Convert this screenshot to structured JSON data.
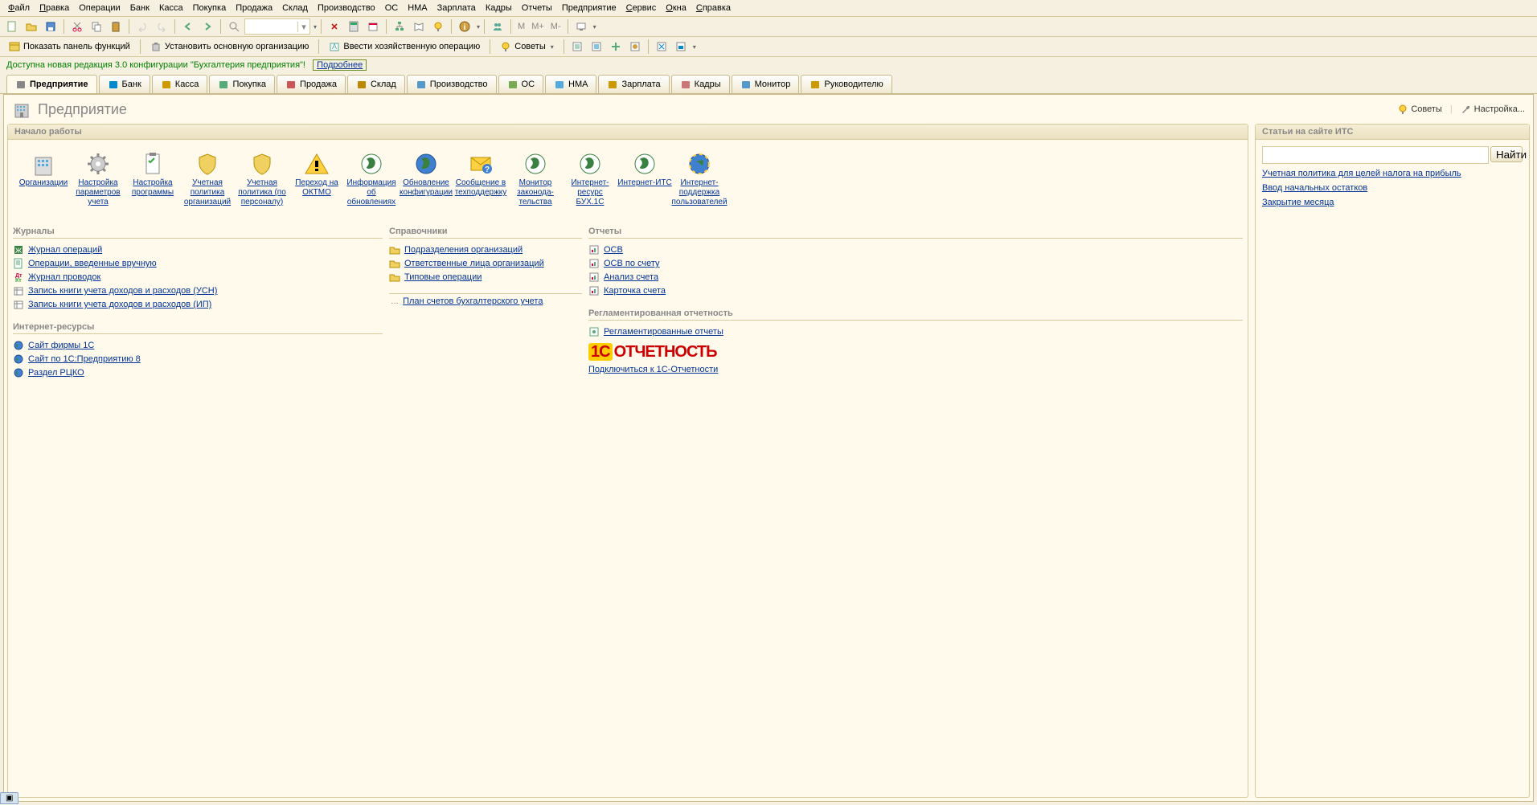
{
  "menu": [
    "Файл",
    "Правка",
    "Операции",
    "Банк",
    "Касса",
    "Покупка",
    "Продажа",
    "Склад",
    "Производство",
    "ОС",
    "НМА",
    "Зарплата",
    "Кадры",
    "Отчеты",
    "Предприятие",
    "Сервис",
    "Окна",
    "Справка"
  ],
  "menu_hot": [
    "Ф",
    "П",
    "",
    "",
    "",
    "",
    "",
    "",
    "",
    "",
    "",
    "",
    "",
    "",
    "",
    "С",
    "О",
    "С"
  ],
  "toolbar2": {
    "show_panel": "Показать панель функций",
    "set_main_org": "Установить основную организацию",
    "enter_oper": "Ввести хозяйственную операцию",
    "advice": "Советы"
  },
  "info": {
    "text": "Доступна новая редакция 3.0 конфигурации \"Бухгалтерия предприятия\"!",
    "more": "Подробнее"
  },
  "tabs": [
    {
      "label": "Предприятие",
      "icon": "building"
    },
    {
      "label": "Банк",
      "icon": "bank"
    },
    {
      "label": "Касса",
      "icon": "cash"
    },
    {
      "label": "Покупка",
      "icon": "cart"
    },
    {
      "label": "Продажа",
      "icon": "sale"
    },
    {
      "label": "Склад",
      "icon": "box"
    },
    {
      "label": "Производство",
      "icon": "gear"
    },
    {
      "label": "ОС",
      "icon": "os"
    },
    {
      "label": "НМА",
      "icon": "nma"
    },
    {
      "label": "Зарплата",
      "icon": "wage"
    },
    {
      "label": "Кадры",
      "icon": "people"
    },
    {
      "label": "Монитор",
      "icon": "screen"
    },
    {
      "label": "Руководителю",
      "icon": "boss"
    }
  ],
  "ws": {
    "title": "Предприятие",
    "advice": "Советы",
    "settings": "Настройка..."
  },
  "start": {
    "header": "Начало работы",
    "items": [
      {
        "label": "Организации",
        "icon": "building"
      },
      {
        "label": "Настройка параметров учета",
        "icon": "gear"
      },
      {
        "label": "Настройка программы",
        "icon": "clipboard"
      },
      {
        "label": "Учетная политика организаций",
        "icon": "shield"
      },
      {
        "label": "Учетная политика (по персоналу)",
        "icon": "shield"
      },
      {
        "label": "Переход на ОКТМО",
        "icon": "warning"
      },
      {
        "label": "Информация об обновлениях",
        "icon": "globe-green"
      },
      {
        "label": "Обновление конфигурации",
        "icon": "globe-blue"
      },
      {
        "label": "Сообщение в техподдержку",
        "icon": "mail"
      },
      {
        "label": "Монитор законода- тельства",
        "icon": "globe-green"
      },
      {
        "label": "Интернет-ресурс БУХ.1С",
        "icon": "globe-green"
      },
      {
        "label": "Интернет-ИТС",
        "icon": "globe-green"
      },
      {
        "label": "Интернет-поддержка пользователей",
        "icon": "globe-multi"
      }
    ]
  },
  "its": {
    "header": "Статьи на сайте ИТС",
    "find": "Найти",
    "links": [
      "Учетная политика для целей налога на прибыль",
      "Ввод начальных остатков",
      "Закрытие месяца"
    ]
  },
  "journals": {
    "header": "Журналы",
    "items": [
      "Журнал операций",
      "Операции, введенные вручную",
      "Журнал проводок",
      "Запись книги учета доходов и расходов (УСН)",
      "Запись книги учета доходов и расходов (ИП)"
    ]
  },
  "iresources": {
    "header": "Интернет-ресурсы",
    "items": [
      "Сайт фирмы 1С",
      "Сайт по 1С:Предприятию 8",
      "Раздел РЦКО"
    ]
  },
  "refs": {
    "header": "Справочники",
    "items": [
      "Подразделения организаций",
      "Ответственные лица организаций",
      "Типовые операции"
    ],
    "plan": "План счетов бухгалтерского учета"
  },
  "reports": {
    "header": "Отчеты",
    "items": [
      "ОСВ",
      "ОСВ по счету",
      "Анализ счета",
      "Карточка счета"
    ]
  },
  "regrep": {
    "header": "Регламентированная отчетность",
    "link": "Регламентированные отчеты",
    "logo": "ОТЧЕТНОСТЬ",
    "connect": "Подключиться к 1С-Отчетности"
  },
  "dots": "..."
}
